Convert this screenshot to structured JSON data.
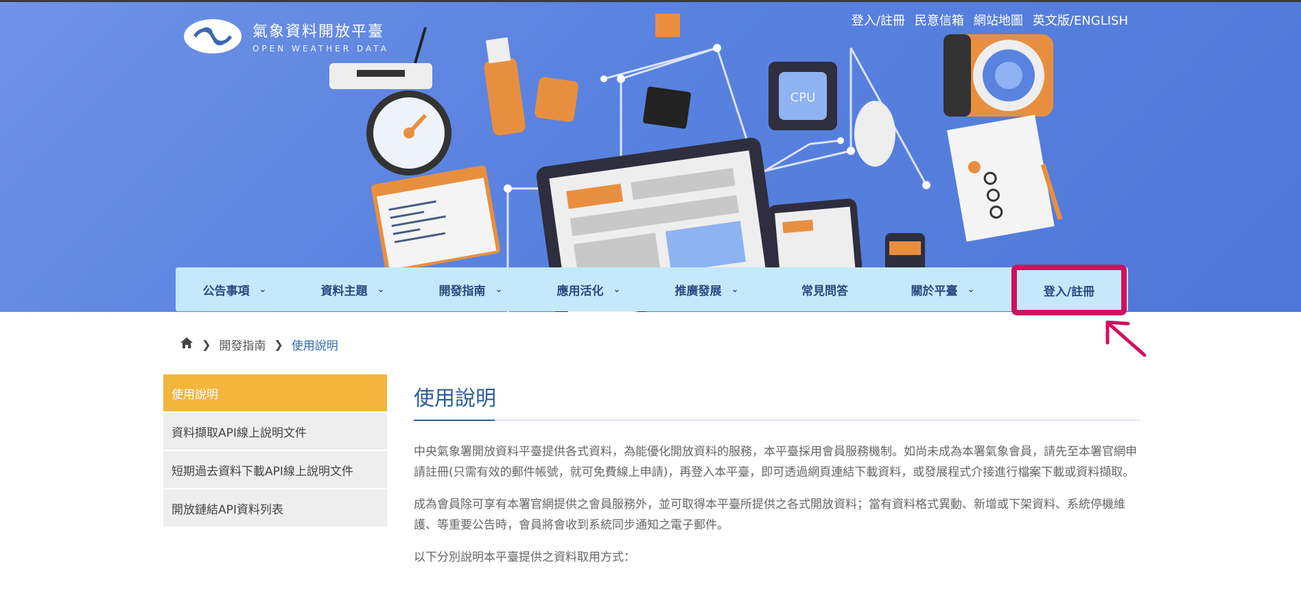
{
  "site": {
    "title": "氣象資料開放平臺",
    "subtitle": "OPEN WEATHER DATA"
  },
  "top_links": [
    "登入/註冊",
    "民意信箱",
    "網站地圖",
    "英文版/ENGLISH"
  ],
  "nav": {
    "items": [
      {
        "label": "公告事項",
        "dropdown": true
      },
      {
        "label": "資料主題",
        "dropdown": true
      },
      {
        "label": "開發指南",
        "dropdown": true
      },
      {
        "label": "應用活化",
        "dropdown": true
      },
      {
        "label": "推廣發展",
        "dropdown": true
      },
      {
        "label": "常見問答",
        "dropdown": false
      },
      {
        "label": "關於平臺",
        "dropdown": true
      }
    ],
    "login_label": "登入/註冊"
  },
  "breadcrumb": {
    "items": [
      "開發指南",
      "使用說明"
    ]
  },
  "sidebar": {
    "items": [
      {
        "label": "使用說明",
        "active": true
      },
      {
        "label": "資料擷取API線上說明文件",
        "active": false
      },
      {
        "label": "短期過去資料下載API線上說明文件",
        "active": false
      },
      {
        "label": "開放鏈結API資料列表",
        "active": false
      }
    ]
  },
  "main": {
    "title": "使用說明",
    "paragraphs": [
      "中央氣象署開放資料平臺提供各式資料，為能優化開放資料的服務，本平臺採用會員服務機制。如尚未成為本署氣象會員，請先至本署官網申請註冊(只需有效的郵件帳號，就可免費線上申請)，再登入本平臺，即可透過網頁連結下載資料，或發展程式介接進行檔案下載或資料擷取。",
      "成為會員除可享有本署官網提供之會員服務外，並可取得本平臺所提供之各式開放資料；當有資料格式異動、新增或下架資料、系統停機維護、等重要公告時，會員將會收到系統同步通知之電子郵件。",
      "以下分別說明本平臺提供之資料取用方式："
    ]
  },
  "colors": {
    "hero_blue": "#5a83e0",
    "nav_bg": "#c4e9fb",
    "nav_text": "#2a4a84",
    "active_sidebar": "#f2b63d",
    "annotation": "#d1105f",
    "title_blue": "#2b5c9a"
  },
  "icons": [
    "home-icon",
    "chevron-right-icon",
    "chevron-down-icon",
    "annotation-arrow-icon"
  ]
}
